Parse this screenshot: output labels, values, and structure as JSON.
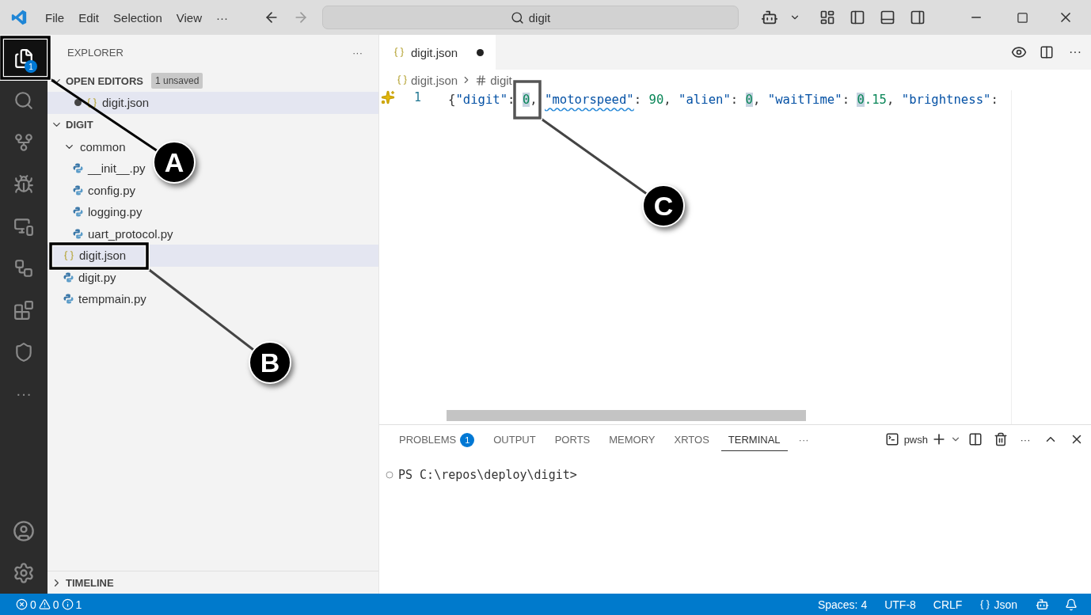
{
  "menu": [
    "File",
    "Edit",
    "Selection",
    "View",
    "···"
  ],
  "command_center": {
    "value": "digit"
  },
  "activity_bar": {
    "items": [
      {
        "kind": "explorer",
        "selected": true,
        "badge": "1"
      },
      {
        "kind": "search",
        "selected": false
      },
      {
        "kind": "source-control",
        "selected": false
      },
      {
        "kind": "run",
        "selected": false
      },
      {
        "kind": "remote",
        "selected": false
      },
      {
        "kind": "flow",
        "selected": false
      },
      {
        "kind": "extensions",
        "selected": false
      },
      {
        "kind": "shield",
        "selected": false
      },
      {
        "kind": "more",
        "selected": false,
        "label": "···"
      }
    ],
    "bottom": [
      {
        "kind": "account"
      },
      {
        "kind": "settings"
      }
    ]
  },
  "sidebar": {
    "title": "EXPLORER",
    "more": "···",
    "open_editors": {
      "title": "OPEN EDITORS",
      "expanded": true,
      "badge": "1 unsaved",
      "items": [
        {
          "name": "digit.json",
          "kind": "json",
          "modified": true,
          "selected": true
        }
      ]
    },
    "folder": {
      "title": "DIGIT",
      "expanded": true,
      "items": [
        {
          "name": "common",
          "kind": "folder",
          "expanded": true,
          "selected": false,
          "children": [
            {
              "name": "__init__.py",
              "kind": "python",
              "selected": false
            },
            {
              "name": "config.py",
              "kind": "python",
              "selected": false
            },
            {
              "name": "logging.py",
              "kind": "python",
              "selected": false
            },
            {
              "name": "uart_protocol.py",
              "kind": "python",
              "selected": false
            }
          ]
        },
        {
          "name": "digit.json",
          "kind": "json",
          "selected": true
        },
        {
          "name": "digit.py",
          "kind": "python",
          "selected": false
        },
        {
          "name": "tempmain.py",
          "kind": "python",
          "selected": false
        }
      ]
    },
    "timeline": {
      "title": "TIMELINE",
      "expanded": false
    }
  },
  "editor": {
    "more": "···",
    "tabs": [
      {
        "label": "digit.json",
        "modified": true,
        "selected": true
      }
    ],
    "breadcrumbs": [
      {
        "label": "digit.json",
        "kind": "json"
      },
      {
        "label": "digit",
        "kind": "number"
      }
    ],
    "lines": [
      {
        "number": "1",
        "tokens": [
          {
            "text": "{",
            "kind": "punct"
          },
          {
            "text": "\"digit\"",
            "kind": "key"
          },
          {
            "text": ": ",
            "kind": "punct"
          },
          {
            "text": "0",
            "kind": "number",
            "highlighted": true
          },
          {
            "text": ", ",
            "kind": "punct"
          },
          {
            "text": "\"motorspeed\"",
            "kind": "key",
            "squiggle": true
          },
          {
            "text": ": ",
            "kind": "punct"
          },
          {
            "text": "90",
            "kind": "number"
          },
          {
            "text": ", ",
            "kind": "punct"
          },
          {
            "text": "\"alien\"",
            "kind": "key"
          },
          {
            "text": ": ",
            "kind": "punct"
          },
          {
            "text": "0",
            "kind": "number",
            "highlighted": true
          },
          {
            "text": ", ",
            "kind": "punct"
          },
          {
            "text": "\"waitTime\"",
            "kind": "key"
          },
          {
            "text": ": ",
            "kind": "punct"
          },
          {
            "text": "0",
            "kind": "number",
            "highlighted": true
          },
          {
            "text": ".15",
            "kind": "number"
          },
          {
            "text": ", ",
            "kind": "punct"
          },
          {
            "text": "\"brightness\"",
            "kind": "key"
          },
          {
            "text": ":",
            "kind": "punct"
          }
        ]
      }
    ]
  },
  "panel": {
    "tabs": [
      {
        "label": "PROBLEMS",
        "badge": "1",
        "selected": false
      },
      {
        "label": "OUTPUT",
        "selected": false
      },
      {
        "label": "PORTS",
        "selected": false
      },
      {
        "label": "MEMORY",
        "selected": false
      },
      {
        "label": "XRTOS",
        "selected": false
      },
      {
        "label": "TERMINAL",
        "selected": true
      }
    ],
    "more": "···",
    "actions_more": "···",
    "terminal_name": "pwsh",
    "lines": [
      "PS C:\\repos\\deploy\\digit>"
    ]
  },
  "status_bar": {
    "errors": "0",
    "warnings": "0",
    "infos": "1",
    "items": [
      "Spaces: 4",
      "UTF-8",
      "CRLF",
      "Json"
    ]
  },
  "callouts": [
    {
      "label": "A"
    },
    {
      "label": "B"
    },
    {
      "label": "C"
    }
  ]
}
